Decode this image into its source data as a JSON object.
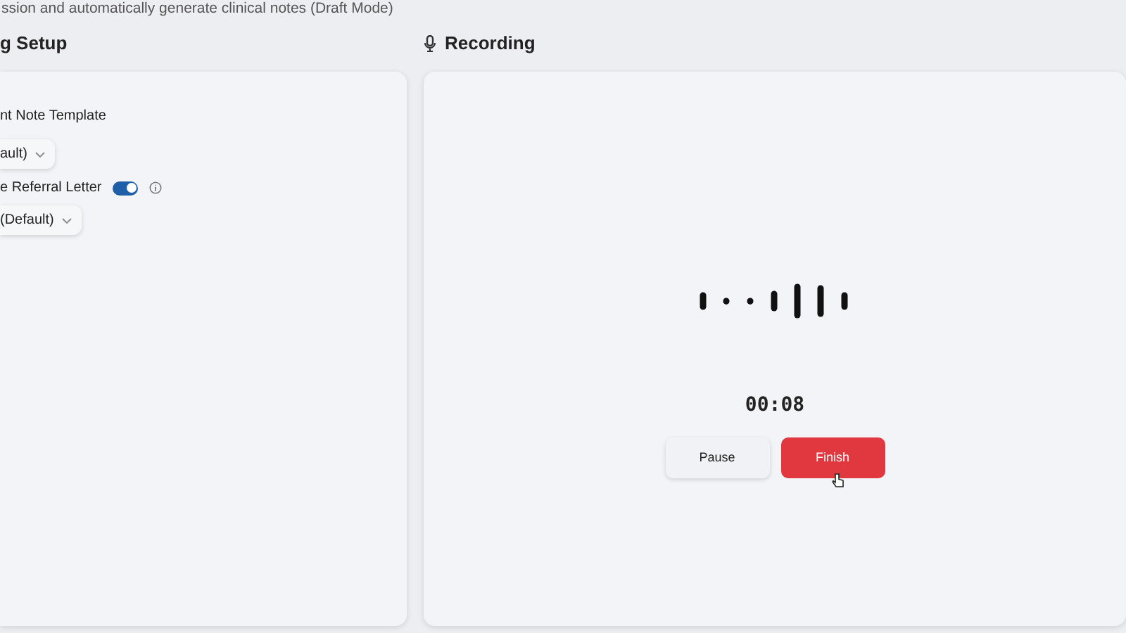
{
  "subtitle": "ssion and automatically generate clinical notes (Draft Mode)",
  "setup": {
    "title": "g Setup",
    "template_label": "nt Note Template",
    "template_select": "ault)",
    "referral": {
      "label": "e Referral Letter",
      "on": true
    },
    "referral_select": "(Default)"
  },
  "recording": {
    "title": "Recording",
    "timer": "00:08",
    "buttons": [
      {
        "label": "Pause",
        "kind": "secondary"
      },
      {
        "label": "Finish",
        "kind": "danger"
      }
    ]
  }
}
